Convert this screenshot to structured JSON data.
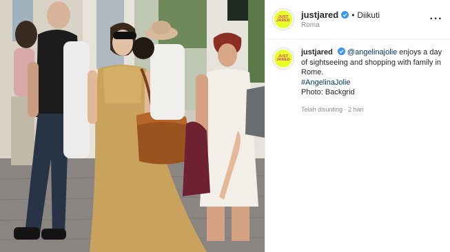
{
  "post": {
    "username": "justjared",
    "follow_status": "Diikuti",
    "location": "Roma",
    "avatar_text": [
      "JUST",
      "JARED"
    ],
    "caption": {
      "mention": "@angelinajolie",
      "text_1": " enjoys a day of sightseeing and shopping with family in Rome.",
      "hashtag": "#AngelinaJolie",
      "photo_credit": "Photo: Backgrid"
    },
    "timestamp": "Telah disunting · 2 hari"
  },
  "colors": {
    "verified": "#3897f0",
    "link": "#00376b",
    "avatar_bg": "#e9ff2b",
    "avatar_text": "#e0347a"
  },
  "icons": {
    "verified": "verified-badge-icon",
    "more": "more-options-icon"
  }
}
